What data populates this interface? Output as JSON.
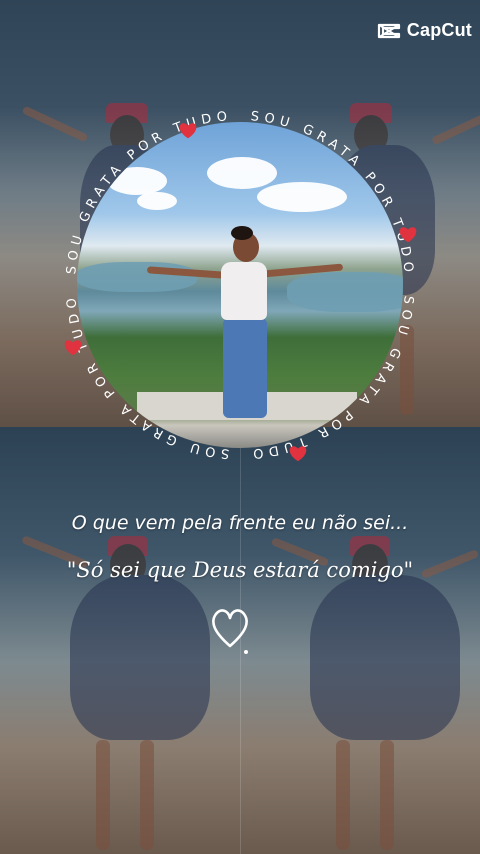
{
  "app": {
    "logo_text": "CapCut"
  },
  "ring": {
    "text": "SOU GRATA POR TUDO",
    "heart_color": "#e0323f"
  },
  "quotes": {
    "line1": "O que vem pela frente eu não sei...",
    "line2": "\"Só sei que Deus estará comigo\""
  },
  "icons": {
    "logo": "capcut-logo-icon",
    "ring_heart": "heart-icon",
    "outline_heart": "heart-outline-icon"
  },
  "colors": {
    "text": "#ffffff",
    "heart": "#e0323f"
  }
}
